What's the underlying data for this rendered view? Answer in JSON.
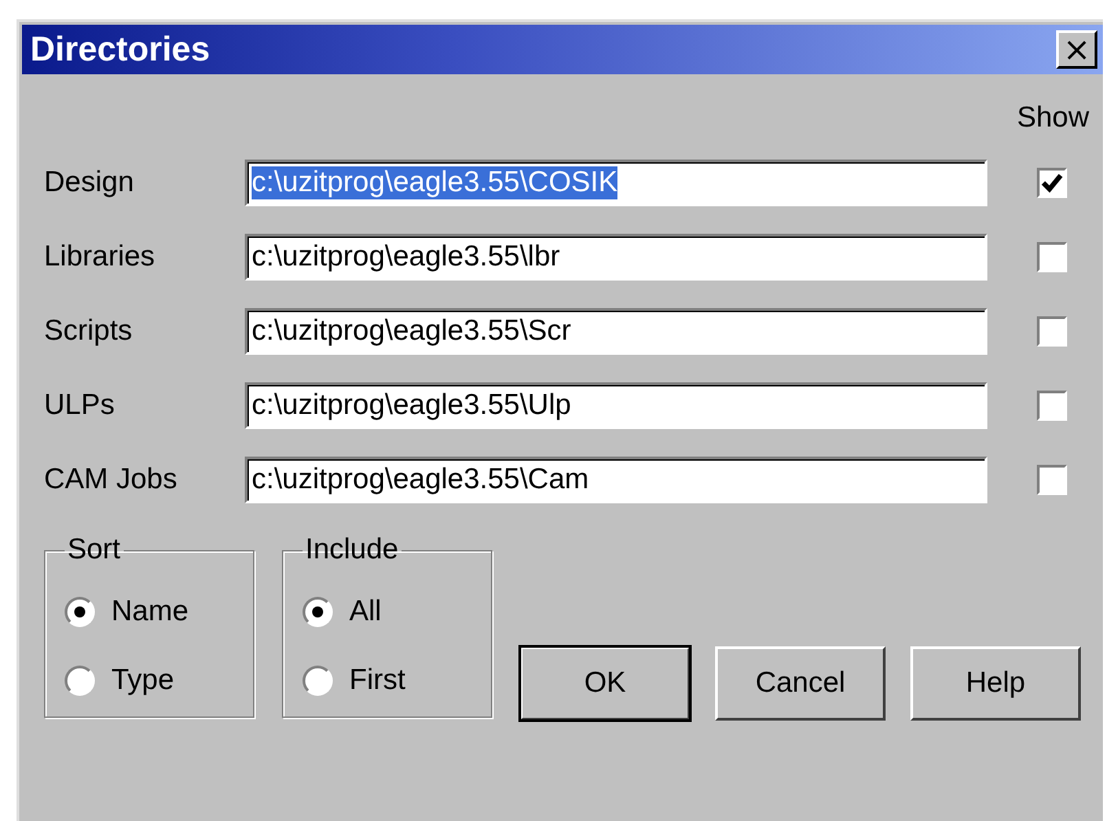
{
  "window": {
    "title": "Directories",
    "close_label": "×"
  },
  "show_header": "Show",
  "rows": [
    {
      "label": "Design",
      "value": "c:\\uzitprog\\eagle3.55\\COSIK",
      "text_selected": true,
      "checked": true
    },
    {
      "label": "Libraries",
      "value": "c:\\uzitprog\\eagle3.55\\lbr",
      "text_selected": false,
      "checked": false
    },
    {
      "label": "Scripts",
      "value": "c:\\uzitprog\\eagle3.55\\Scr",
      "text_selected": false,
      "checked": false
    },
    {
      "label": "ULPs",
      "value": "c:\\uzitprog\\eagle3.55\\Ulp",
      "text_selected": false,
      "checked": false
    },
    {
      "label": "CAM Jobs",
      "value": "c:\\uzitprog\\eagle3.55\\Cam",
      "text_selected": false,
      "checked": false
    }
  ],
  "groups": [
    {
      "title": "Sort",
      "options": [
        {
          "label": "Name",
          "selected": true
        },
        {
          "label": "Type",
          "selected": false
        }
      ]
    },
    {
      "title": "Include",
      "options": [
        {
          "label": "All",
          "selected": true
        },
        {
          "label": "First",
          "selected": false
        }
      ]
    }
  ],
  "buttons": [
    {
      "label": "OK",
      "default": true
    },
    {
      "label": "Cancel",
      "default": false
    },
    {
      "label": "Help",
      "default": false
    }
  ]
}
